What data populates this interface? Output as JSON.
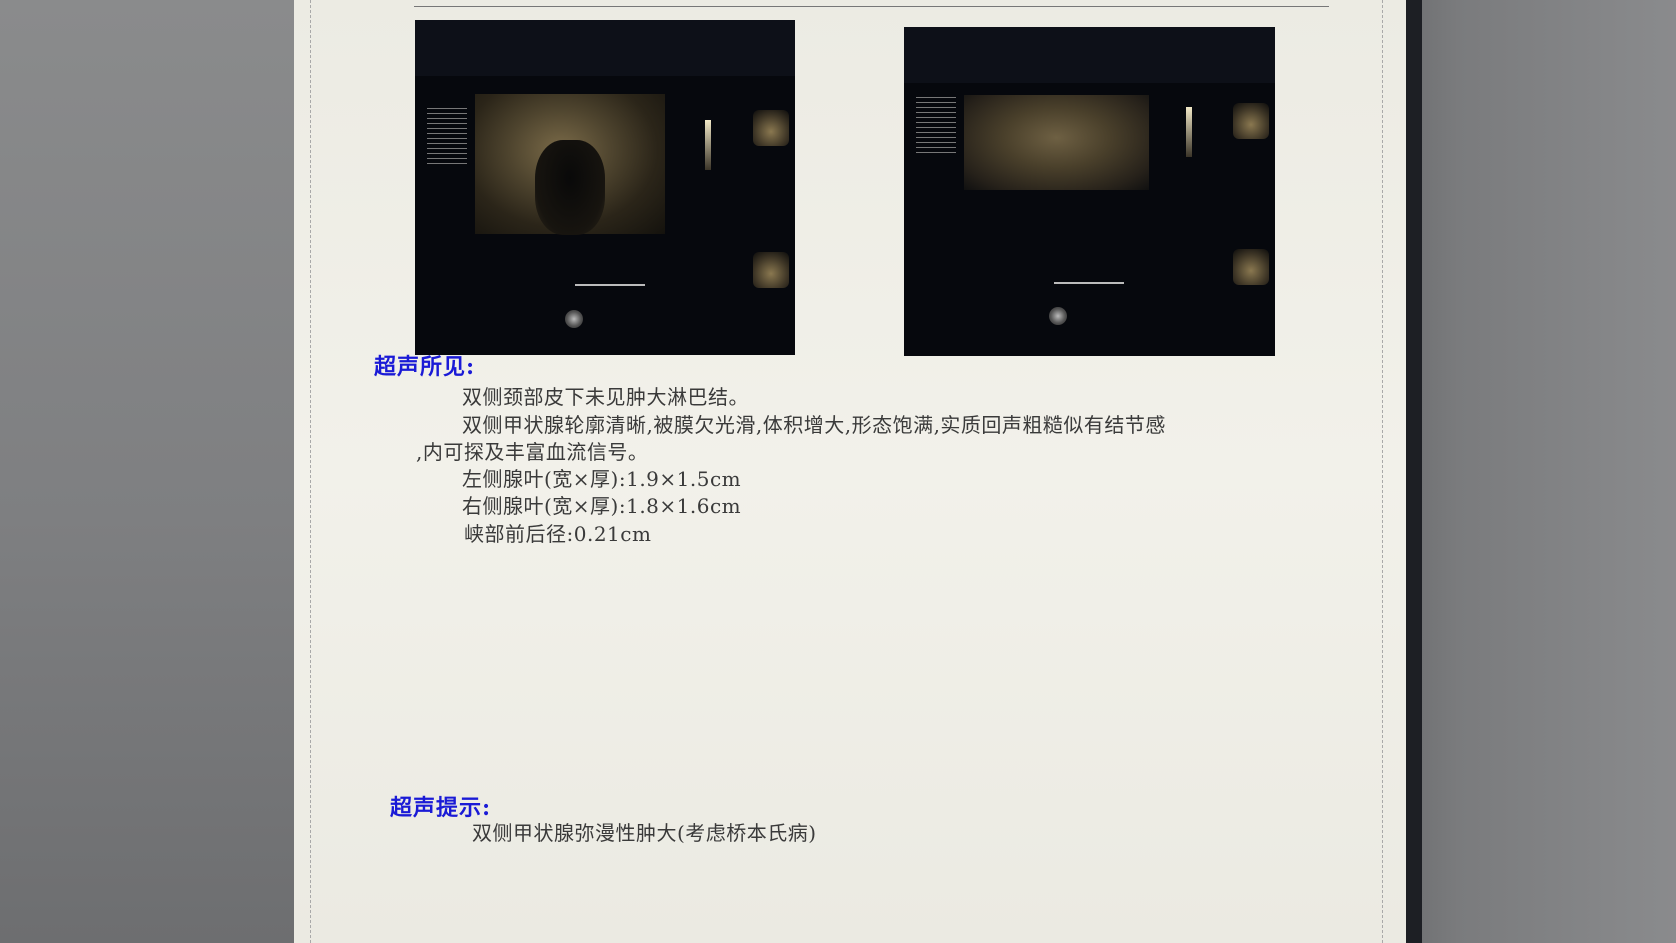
{
  "report": {
    "findings_title": "超声所见:",
    "findings_lines": [
      "双侧颈部皮下未见肿大淋巴结。",
      "双侧甲状腺轮廓清晰,被膜欠光滑,体积增大,形态饱满,实质回声粗糙似有结节感",
      ",内可探及丰富血流信号。",
      "左侧腺叶(宽×厚):1.9×1.5cm",
      "右侧腺叶(宽×厚):1.8×1.6cm",
      "峡部前后径:0.21cm"
    ],
    "impression_title": "超声提示:",
    "impression_lines": [
      "双侧甲状腺弥漫性肿大(考虑桥本氏病)"
    ]
  },
  "colors": {
    "section_title": "#1a1ad6",
    "body_text": "#3a3a3a",
    "paper": "#f0efe8"
  }
}
